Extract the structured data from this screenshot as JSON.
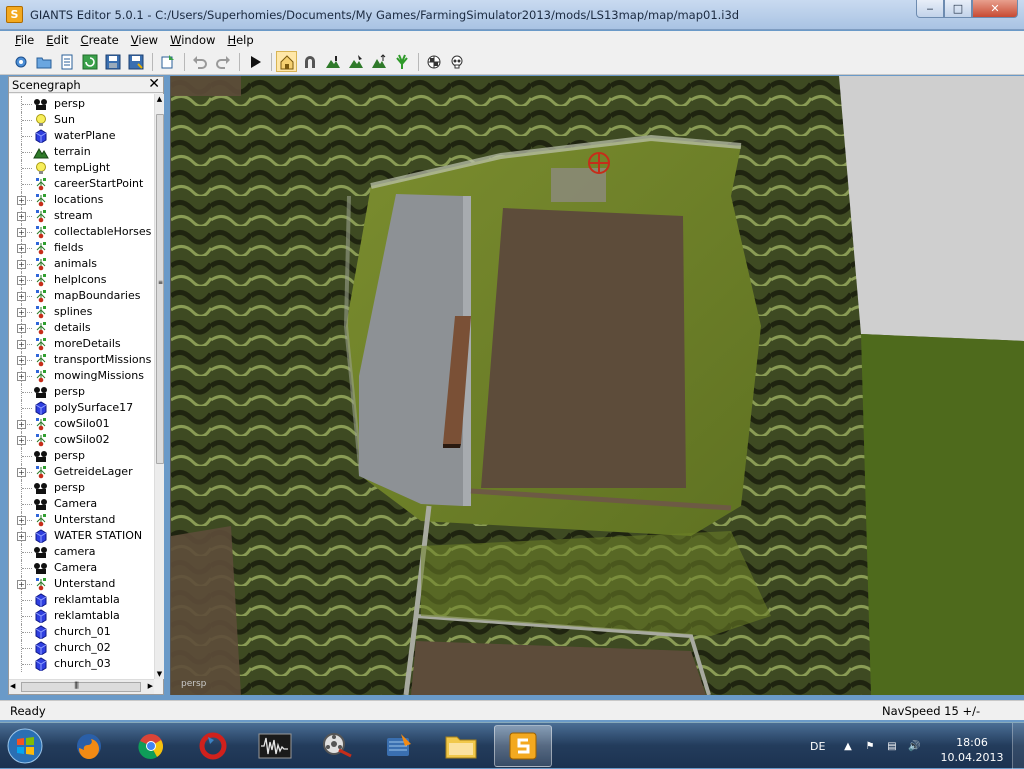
{
  "window": {
    "app_icon": "S",
    "title": "GIANTS Editor 5.0.1 - C:/Users/Superhomies/Documents/My Games/FarmingSimulator2013/mods/LS13map/map/map01.i3d",
    "minimize": "‒",
    "maximize": "□",
    "close": "✕"
  },
  "menu": [
    {
      "label": "File",
      "key": "F",
      "rest": "ile"
    },
    {
      "label": "Edit",
      "key": "E",
      "rest": "dit"
    },
    {
      "label": "Create",
      "key": "C",
      "rest": "reate"
    },
    {
      "label": "View",
      "key": "V",
      "rest": "iew"
    },
    {
      "label": "Window",
      "key": "W",
      "rest": "indow"
    },
    {
      "label": "Help",
      "key": "H",
      "rest": "elp"
    }
  ],
  "toolbar_icons": [
    "new-scene-icon",
    "open-icon",
    "document-icon",
    "refresh-icon",
    "save-icon",
    "save-as-icon",
    "import-icon",
    "undo-icon",
    "redo-icon",
    "play-icon",
    "home-icon",
    "magnet-icon",
    "terrain-sculpt-icon",
    "terrain-paint-icon",
    "foliage-paint-icon",
    "checker-icon",
    "skull-icon"
  ],
  "scenegraph": {
    "title": "Scenegraph",
    "close": "✕",
    "items": [
      {
        "label": "persp",
        "icon": "camera-icon",
        "expandable": false
      },
      {
        "label": "Sun",
        "icon": "light-icon",
        "expandable": false
      },
      {
        "label": "waterPlane",
        "icon": "shape-icon",
        "expandable": false
      },
      {
        "label": "terrain",
        "icon": "terrain-icon",
        "expandable": false
      },
      {
        "label": "tempLight",
        "icon": "light-icon",
        "expandable": false
      },
      {
        "label": "careerStartPoint",
        "icon": "transform-group-icon",
        "expandable": false
      },
      {
        "label": "locations",
        "icon": "transform-group-icon",
        "expandable": true
      },
      {
        "label": "stream",
        "icon": "transform-group-icon",
        "expandable": true
      },
      {
        "label": "collectableHorses",
        "icon": "transform-group-icon",
        "expandable": true
      },
      {
        "label": "fields",
        "icon": "transform-group-icon",
        "expandable": true
      },
      {
        "label": "animals",
        "icon": "transform-group-icon",
        "expandable": true
      },
      {
        "label": "helpIcons",
        "icon": "transform-group-icon",
        "expandable": true
      },
      {
        "label": "mapBoundaries",
        "icon": "transform-group-icon",
        "expandable": true
      },
      {
        "label": "splines",
        "icon": "transform-group-icon",
        "expandable": true
      },
      {
        "label": "details",
        "icon": "transform-group-icon",
        "expandable": true
      },
      {
        "label": "moreDetails",
        "icon": "transform-group-icon",
        "expandable": true
      },
      {
        "label": "transportMissions",
        "icon": "transform-group-icon",
        "expandable": true
      },
      {
        "label": "mowingMissions",
        "icon": "transform-group-icon",
        "expandable": true
      },
      {
        "label": "persp",
        "icon": "camera-icon",
        "expandable": false
      },
      {
        "label": "polySurface17",
        "icon": "shape-icon",
        "expandable": false
      },
      {
        "label": "cowSilo01",
        "icon": "transform-group-icon",
        "expandable": true
      },
      {
        "label": "cowSilo02",
        "icon": "transform-group-icon",
        "expandable": true
      },
      {
        "label": "persp",
        "icon": "camera-icon",
        "expandable": false
      },
      {
        "label": "GetreideLager",
        "icon": "transform-group-icon",
        "expandable": true
      },
      {
        "label": "persp",
        "icon": "camera-icon",
        "expandable": false
      },
      {
        "label": "Camera",
        "icon": "camera-icon",
        "expandable": false
      },
      {
        "label": "Unterstand",
        "icon": "transform-group-icon",
        "expandable": true
      },
      {
        "label": "WATER STATION",
        "icon": "shape-icon",
        "expandable": true
      },
      {
        "label": "camera",
        "icon": "camera-icon",
        "expandable": false
      },
      {
        "label": "Camera",
        "icon": "camera-icon",
        "expandable": false
      },
      {
        "label": "Unterstand",
        "icon": "transform-group-icon",
        "expandable": true
      },
      {
        "label": "reklamtabla",
        "icon": "shape-icon",
        "expandable": false
      },
      {
        "label": "reklamtabla",
        "icon": "shape-icon",
        "expandable": false
      },
      {
        "label": "church_01",
        "icon": "shape-icon",
        "expandable": false
      },
      {
        "label": "church_02",
        "icon": "shape-icon",
        "expandable": false
      },
      {
        "label": "church_03",
        "icon": "shape-icon",
        "expandable": false
      }
    ],
    "scroll_up": "▲",
    "scroll_down": "▼",
    "scroll_left": "◀",
    "scroll_right": "▶",
    "scroll_grip": "|||"
  },
  "viewport": {
    "camera_label": "persp"
  },
  "status": {
    "left": "Ready",
    "right": "NavSpeed 15 +/-"
  },
  "taskbar": {
    "apps": [
      "firefox-icon",
      "chrome-icon",
      "opera-icon",
      "audio-editor-icon",
      "video-player-icon",
      "archive-tool-icon",
      "file-explorer-icon",
      "giants-editor-icon"
    ],
    "language": "DE",
    "time": "18:06",
    "date": "10.04.2013"
  },
  "colors": {
    "accent": "#f3a920",
    "titlebar": "#a9c3e3",
    "taskbar": "#233c5c"
  }
}
